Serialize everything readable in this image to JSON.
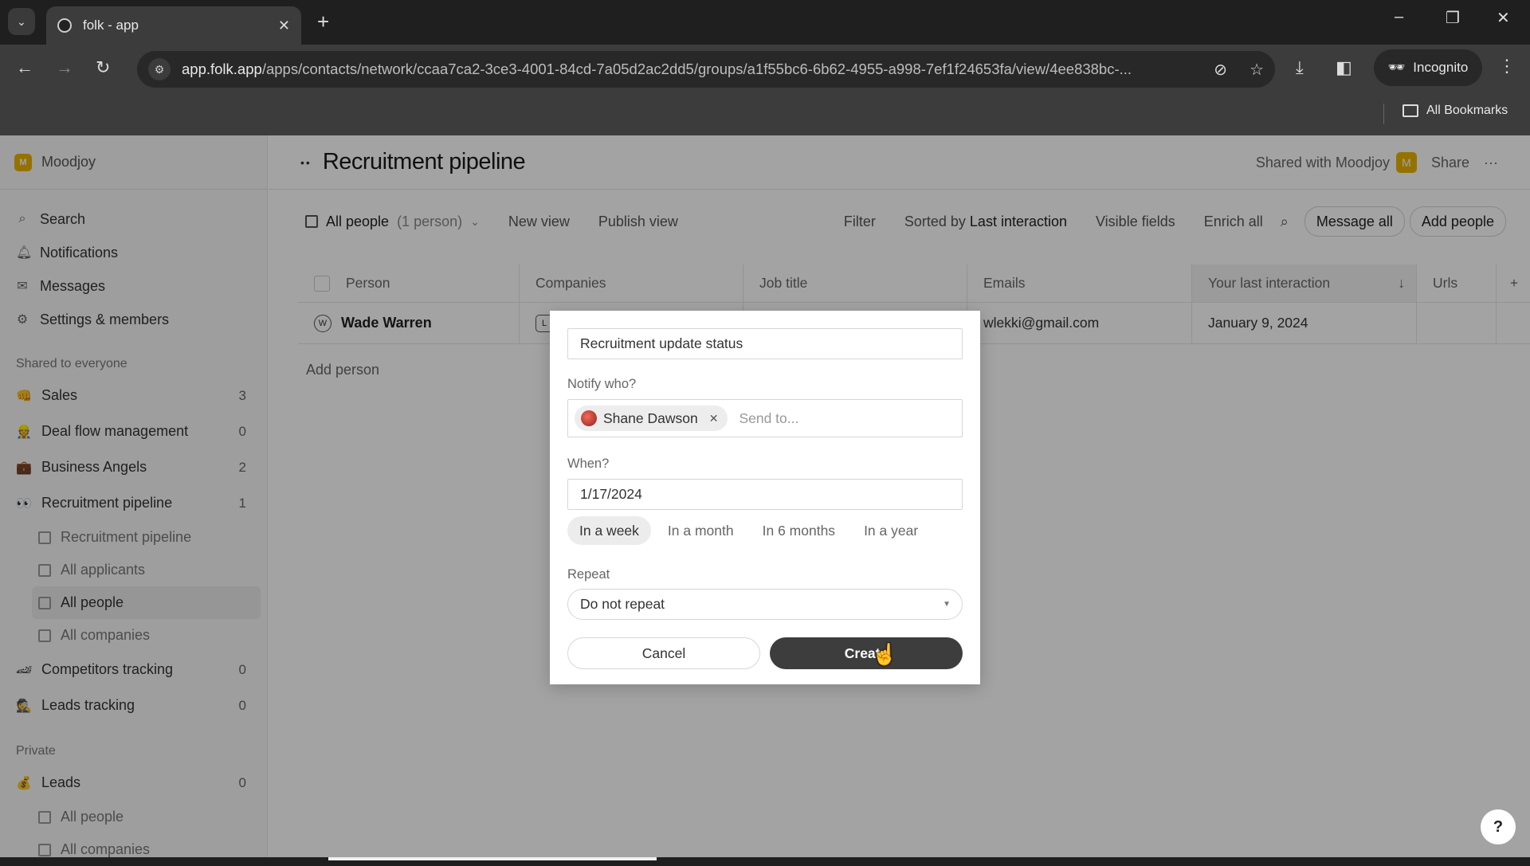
{
  "browser": {
    "tab_title": "folk - app",
    "url_host": "app.folk.app",
    "url_path": "/apps/contacts/network/ccaa7ca2-3ce3-4001-84cd-7a05d2ac2dd5/groups/a1f55bc6-6b62-4955-a998-7ef1f24653fa/view/4ee838bc-...",
    "profile_label": "Incognito",
    "bookmarks_label": "All Bookmarks"
  },
  "sidebar": {
    "workspace": {
      "logo_letter": "M",
      "name": "Moodjoy"
    },
    "nav": [
      {
        "icon": "search-icon",
        "label": "Search"
      },
      {
        "icon": "bell-icon",
        "label": "Notifications"
      },
      {
        "icon": "mail-icon",
        "label": "Messages"
      },
      {
        "icon": "gear-icon",
        "label": "Settings & members"
      }
    ],
    "shared_label": "Shared to everyone",
    "shared_groups": [
      {
        "emoji": "👊",
        "label": "Sales",
        "count": "3"
      },
      {
        "emoji": "👷",
        "label": "Deal flow management",
        "count": "0"
      },
      {
        "emoji": "💼",
        "label": "Business Angels",
        "count": "2"
      },
      {
        "emoji": "👀",
        "label": "Recruitment pipeline",
        "count": "1"
      }
    ],
    "recruitment_views": [
      "Recruitment pipeline",
      "All applicants",
      "All people",
      "All companies"
    ],
    "more_groups": [
      {
        "emoji": "🏎",
        "label": "Competitors tracking",
        "count": "0"
      },
      {
        "emoji": "🕵",
        "label": "Leads tracking",
        "count": "0"
      }
    ],
    "private_label": "Private",
    "private_groups": [
      {
        "emoji": "💰",
        "label": "Leads",
        "count": "0"
      }
    ],
    "leads_views": [
      "All people",
      "All companies"
    ]
  },
  "header": {
    "icon": "eyes-icon",
    "title": "Recruitment pipeline",
    "shared_with": "Shared with Moodjoy",
    "shared_badge": "M",
    "share_label": "Share",
    "more_label": "···"
  },
  "viewbar": {
    "current_view": "All people",
    "current_count": "(1 person)",
    "new_view": "New view",
    "publish_view": "Publish view",
    "filter": "Filter",
    "sorted_prefix": "Sorted by",
    "sorted_field": "Last interaction",
    "visible_fields": "Visible fields",
    "enrich_all": "Enrich all",
    "message_all": "Message all",
    "add_people": "Add people"
  },
  "table": {
    "columns": [
      "Person",
      "Companies",
      "Job title",
      "Emails",
      "Your last interaction",
      "Urls"
    ],
    "add_column": "+",
    "rows": [
      {
        "avatar": "W",
        "person": "Wade Warren",
        "company_badge": "L",
        "job_title": "",
        "email": "wlekki@gmail.com",
        "last_interaction": "January 9, 2024",
        "urls": ""
      }
    ],
    "add_person": "Add person"
  },
  "modal": {
    "title_value": "Recruitment update status",
    "notify_label": "Notify who?",
    "recipients": [
      {
        "name": "Shane Dawson"
      }
    ],
    "send_to_placeholder": "Send to...",
    "when_label": "When?",
    "date_value": "1/17/2024",
    "quick_options": [
      "In a week",
      "In a month",
      "In 6 months",
      "In a year"
    ],
    "quick_selected": "In a week",
    "repeat_label": "Repeat",
    "repeat_value": "Do not repeat",
    "cancel_label": "Cancel",
    "create_label": "Create"
  },
  "help_label": "?"
}
